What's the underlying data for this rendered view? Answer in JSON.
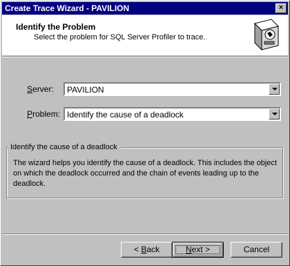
{
  "window": {
    "title": "Create Trace Wizard - PAVILION",
    "close_glyph": "×"
  },
  "header": {
    "title": "Identify the Problem",
    "subtitle": "Select the problem for SQL Server Profiler to trace.",
    "icon": "wizard-wand-icon"
  },
  "fields": {
    "server": {
      "label_prefix": "",
      "label_mnemonic": "S",
      "label_rest": "erver:",
      "value": "PAVILION"
    },
    "problem": {
      "label_prefix": "",
      "label_mnemonic": "P",
      "label_rest": "roblem:",
      "value": "Identify the cause of a deadlock"
    }
  },
  "description": {
    "heading": "Identify the cause of a deadlock",
    "text": "The wizard helps you identify the cause of a deadlock. This includes the object on which the deadlock occurred and the chain of events leading up to the deadlock."
  },
  "buttons": {
    "back": {
      "prefix": "< ",
      "mnemonic": "B",
      "rest": "ack"
    },
    "next": {
      "prefix": "",
      "mnemonic": "N",
      "rest": "ext >"
    },
    "cancel": "Cancel"
  }
}
